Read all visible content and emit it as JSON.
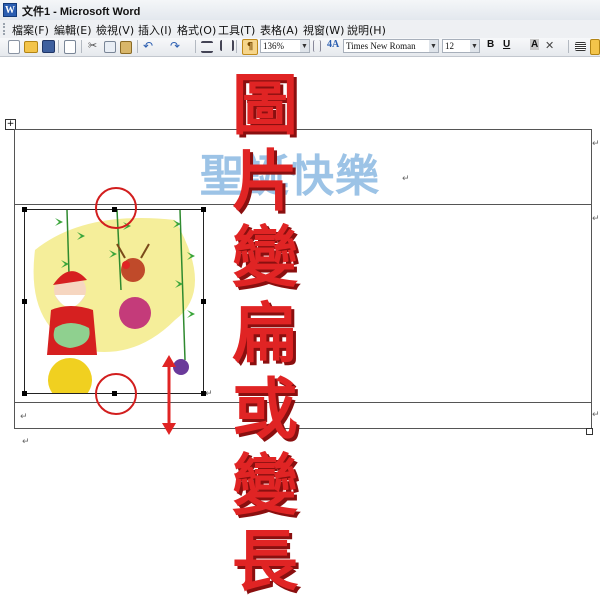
{
  "window": {
    "title": "文件1 - Microsoft Word",
    "app_icon": "word-doc-icon"
  },
  "menu": {
    "items": [
      "檔案(F)",
      "編輯(E)",
      "檢視(V)",
      "插入(I)",
      "格式(O)",
      "工具(T)",
      "表格(A)",
      "視窗(W)",
      "說明(H)"
    ]
  },
  "toolbar": {
    "zoom": "136%",
    "font_name": "Times New Roman",
    "font_size": "12",
    "bold_label": "B",
    "underline_label": "U",
    "char_shading_label": "A"
  },
  "document": {
    "heading_text": "聖誕快樂",
    "annotation_chars": [
      "圖",
      "片",
      "變",
      "扁",
      "或",
      "變",
      "長"
    ],
    "paragraph_mark": "↵",
    "colors": {
      "heading": "#9cc3e6",
      "annotation": "#e02424",
      "circle": "#d21e1e"
    }
  }
}
